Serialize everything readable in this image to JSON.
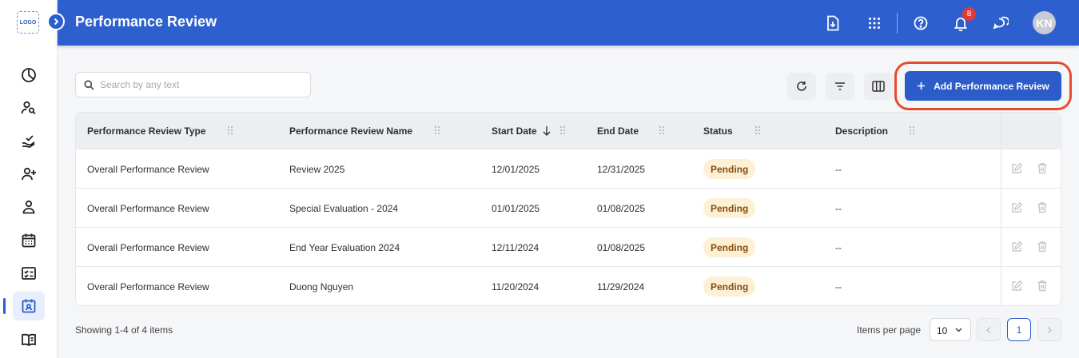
{
  "logo_text": "LOGO",
  "header": {
    "title": "Performance Review",
    "notification_count": "8",
    "avatar_initials": "KN"
  },
  "sidebar": {
    "items": [
      {
        "icon": "pie-chart-icon"
      },
      {
        "icon": "user-search-icon"
      },
      {
        "icon": "hand-check-icon"
      },
      {
        "icon": "user-add-icon"
      },
      {
        "icon": "user-icon"
      },
      {
        "icon": "calendar-icon"
      },
      {
        "icon": "checklist-icon"
      },
      {
        "icon": "performance-review-icon",
        "active": true
      },
      {
        "icon": "book-icon"
      }
    ]
  },
  "toolbar": {
    "search_placeholder": "Search by any text",
    "add_label": "Add Performance Review"
  },
  "table": {
    "columns": [
      "Performance Review Type",
      "Performance Review Name",
      "Start Date",
      "End Date",
      "Status",
      "Description"
    ],
    "rows": [
      {
        "type": "Overall Performance Review",
        "name": "Review 2025",
        "start": "12/01/2025",
        "end": "12/31/2025",
        "status": "Pending",
        "description": "--"
      },
      {
        "type": "Overall Performance Review",
        "name": "Special Evaluation - 2024",
        "start": "01/01/2025",
        "end": "01/08/2025",
        "status": "Pending",
        "description": "--"
      },
      {
        "type": "Overall Performance Review",
        "name": "End Year Evaluation 2024",
        "start": "12/11/2024",
        "end": "01/08/2025",
        "status": "Pending",
        "description": "--"
      },
      {
        "type": "Overall Performance Review",
        "name": "Duong Nguyen",
        "start": "11/20/2024",
        "end": "11/29/2024",
        "status": "Pending",
        "description": "--"
      }
    ]
  },
  "footer": {
    "showing": "Showing 1-4 of 4 items",
    "items_per_page_label": "Items per page",
    "items_per_page": "10",
    "current_page": "1"
  },
  "colors": {
    "primary": "#2d5fce",
    "highlight_ring": "#e84a2f",
    "pending_bg": "#fcf1d5",
    "pending_text": "#8a4b0d"
  }
}
